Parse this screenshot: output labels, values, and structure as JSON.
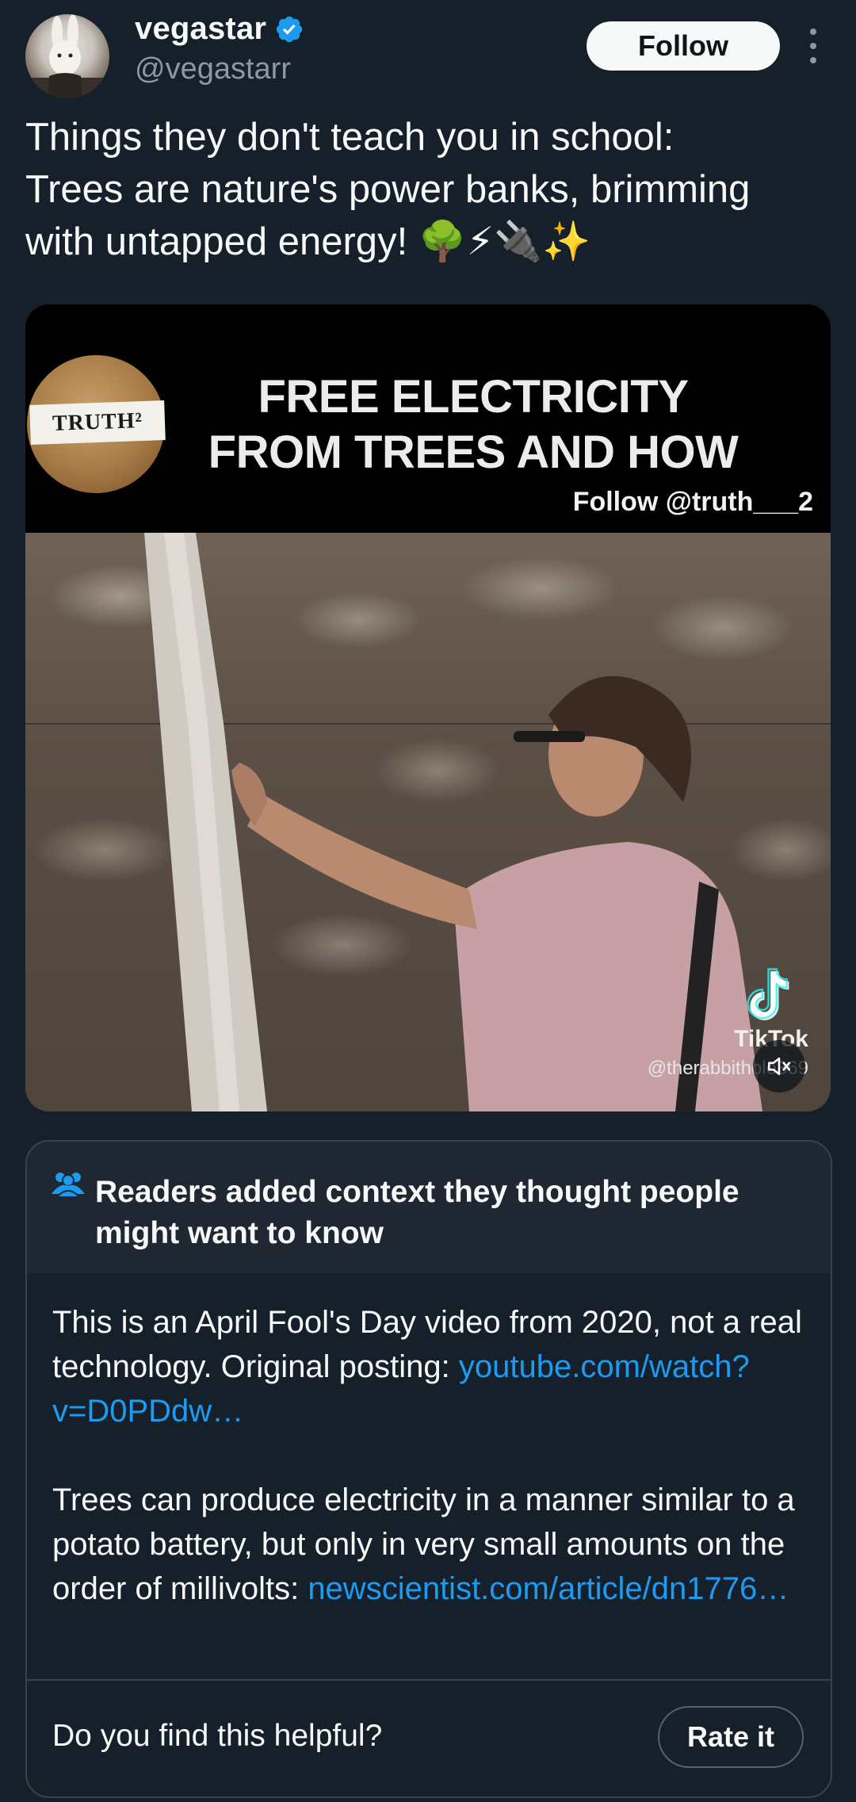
{
  "author": {
    "display_name": "vegastar",
    "handle": "@vegastarr",
    "verified": true,
    "follow_label": "Follow"
  },
  "tweet": {
    "text": "Things they don't teach you in school:\nTrees are nature's power banks, brimming\nwith untapped energy! 🌳⚡🔌✨"
  },
  "media": {
    "logo_text": "TRUTH²",
    "title_line1": "FREE ELECTRICITY",
    "title_line2": "FROM TREES AND HOW",
    "follow_overlay": "Follow @truth___2",
    "tiktok_label": "TikTok",
    "tiktok_user": "@therabbithole369",
    "muted": true
  },
  "community_note": {
    "header": "Readers added context they thought people might want to know",
    "paragraph1_text": "This is an April Fool's Day video from 2020, not a real technology. Original posting: ",
    "paragraph1_link": "youtube.com/watch?v=D0PDdw…",
    "paragraph2_text": "Trees can produce electricity in a manner similar to a potato battery, but only in very small amounts on the order of millivolts: ",
    "paragraph2_link": "newscientist.com/article/dn1776…",
    "helpful_question": "Do you find this helpful?",
    "rate_label": "Rate it"
  },
  "colors": {
    "background": "#15202b",
    "link": "#1d9bf0",
    "verified": "#1d9bf0",
    "muted_text": "#8b98a5"
  }
}
